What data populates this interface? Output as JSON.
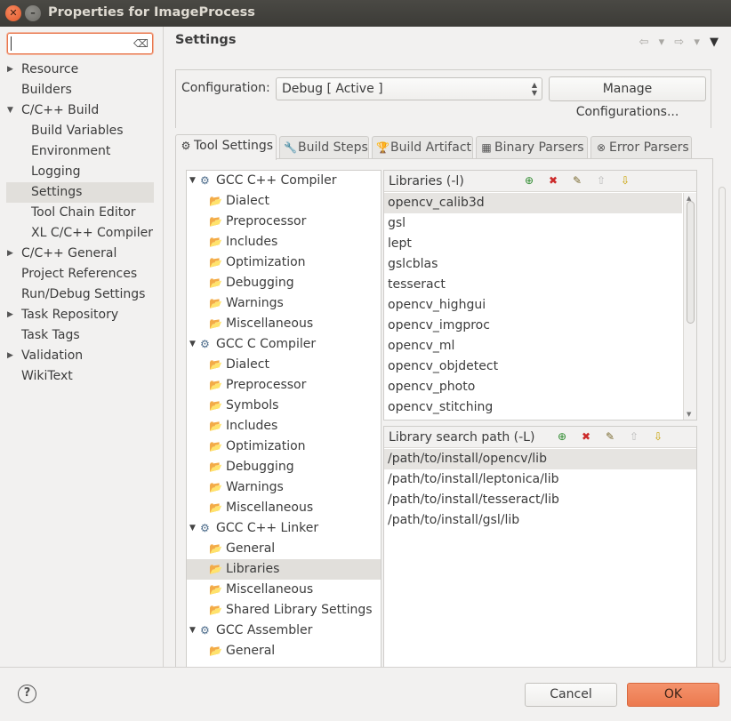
{
  "window": {
    "title": "Properties for ImageProcess",
    "close_glyph": "✕",
    "minimize_glyph": "–"
  },
  "sidebar": {
    "filter_value": "",
    "filter_clear_glyph": "⌫",
    "items": [
      {
        "label": "Resource",
        "arrow": "▶",
        "child": false
      },
      {
        "label": "Builders",
        "arrow": "",
        "child": false
      },
      {
        "label": "C/C++ Build",
        "arrow": "▼",
        "child": false
      },
      {
        "label": "Build Variables",
        "arrow": "",
        "child": true
      },
      {
        "label": "Environment",
        "arrow": "",
        "child": true
      },
      {
        "label": "Logging",
        "arrow": "",
        "child": true
      },
      {
        "label": "Settings",
        "arrow": "",
        "child": true,
        "selected": true
      },
      {
        "label": "Tool Chain Editor",
        "arrow": "",
        "child": true
      },
      {
        "label": "XL C/C++ Compiler",
        "arrow": "",
        "child": true
      },
      {
        "label": "C/C++ General",
        "arrow": "▶",
        "child": false
      },
      {
        "label": "Project References",
        "arrow": "",
        "child": false
      },
      {
        "label": "Run/Debug Settings",
        "arrow": "",
        "child": false
      },
      {
        "label": "Task Repository",
        "arrow": "▶",
        "child": false
      },
      {
        "label": "Task Tags",
        "arrow": "",
        "child": false
      },
      {
        "label": "Validation",
        "arrow": "▶",
        "child": false
      },
      {
        "label": "WikiText",
        "arrow": "",
        "child": false
      }
    ]
  },
  "header": {
    "title": "Settings",
    "back_icon": "⇦",
    "forward_icon": "⇨",
    "dropdown_icon": "▾",
    "menu_icon": "▼"
  },
  "configuration": {
    "label": "Configuration:",
    "selected": "Debug  [ Active ]",
    "spin_up": "▲",
    "spin_down": "▼",
    "manage_button": "Manage Configurations..."
  },
  "tabs": [
    {
      "label": "Tool Settings",
      "icon": "⚙",
      "active": true
    },
    {
      "label": "Build Steps",
      "icon": "🔧",
      "active": false
    },
    {
      "label": "Build Artifact",
      "icon": "🏆",
      "active": false
    },
    {
      "label": "Binary Parsers",
      "icon": "▦",
      "active": false
    },
    {
      "label": "Error Parsers",
      "icon": "⊗",
      "active": false
    }
  ],
  "tool_tree": [
    {
      "label": "GCC C++ Compiler",
      "type": "parent",
      "arrow": "▼",
      "icon": "⚙"
    },
    {
      "label": "Dialect",
      "type": "leaf",
      "icon": "📂"
    },
    {
      "label": "Preprocessor",
      "type": "leaf",
      "icon": "📂"
    },
    {
      "label": "Includes",
      "type": "leaf",
      "icon": "📂"
    },
    {
      "label": "Optimization",
      "type": "leaf",
      "icon": "📂"
    },
    {
      "label": "Debugging",
      "type": "leaf",
      "icon": "📂"
    },
    {
      "label": "Warnings",
      "type": "leaf",
      "icon": "📂"
    },
    {
      "label": "Miscellaneous",
      "type": "leaf",
      "icon": "📂"
    },
    {
      "label": "GCC C Compiler",
      "type": "parent",
      "arrow": "▼",
      "icon": "⚙"
    },
    {
      "label": "Dialect",
      "type": "leaf",
      "icon": "📂"
    },
    {
      "label": "Preprocessor",
      "type": "leaf",
      "icon": "📂"
    },
    {
      "label": "Symbols",
      "type": "leaf",
      "icon": "📂"
    },
    {
      "label": "Includes",
      "type": "leaf",
      "icon": "📂"
    },
    {
      "label": "Optimization",
      "type": "leaf",
      "icon": "📂"
    },
    {
      "label": "Debugging",
      "type": "leaf",
      "icon": "📂"
    },
    {
      "label": "Warnings",
      "type": "leaf",
      "icon": "📂"
    },
    {
      "label": "Miscellaneous",
      "type": "leaf",
      "icon": "📂"
    },
    {
      "label": "GCC C++ Linker",
      "type": "parent",
      "arrow": "▼",
      "icon": "⚙"
    },
    {
      "label": "General",
      "type": "leaf",
      "icon": "📂"
    },
    {
      "label": "Libraries",
      "type": "leaf",
      "icon": "📂",
      "selected": true
    },
    {
      "label": "Miscellaneous",
      "type": "leaf",
      "icon": "📂"
    },
    {
      "label": "Shared Library Settings",
      "type": "leaf",
      "icon": "📂"
    },
    {
      "label": "GCC Assembler",
      "type": "parent",
      "arrow": "▼",
      "icon": "⚙"
    },
    {
      "label": "General",
      "type": "leaf",
      "icon": "📂"
    }
  ],
  "libraries": {
    "title": "Libraries (-l)",
    "tools": {
      "add": "⊕",
      "delete": "✖",
      "edit": "✎",
      "up": "⇧",
      "down": "⇩"
    },
    "items": [
      "opencv_calib3d",
      "gsl",
      "lept",
      "gslcblas",
      "tesseract",
      "opencv_highgui",
      "opencv_imgproc",
      "opencv_ml",
      "opencv_objdetect",
      "opencv_photo",
      "opencv_stitching"
    ],
    "scroll_up": "▲",
    "scroll_down": "▼"
  },
  "search_paths": {
    "title": "Library search path (-L)",
    "tools": {
      "add": "⊕",
      "delete": "✖",
      "edit": "✎",
      "up": "⇧",
      "down": "⇩"
    },
    "items": [
      "/path/to/install/opencv/lib",
      "/path/to/install/leptonica/lib",
      "/path/to/install/tesseract/lib",
      "/path/to/install/gsl/lib"
    ]
  },
  "footer": {
    "help_icon": "?",
    "cancel": "Cancel",
    "ok": "OK"
  }
}
